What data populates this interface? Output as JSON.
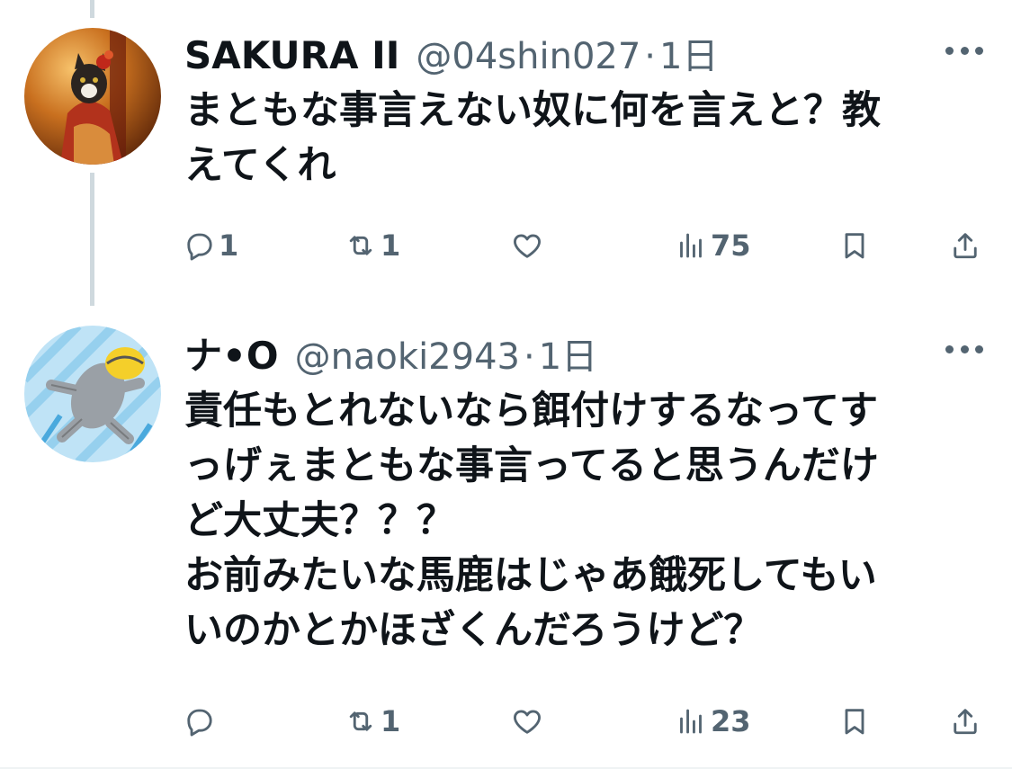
{
  "tweets": [
    {
      "name": "SAKURA II",
      "handle": "@04shin027",
      "separator": "·",
      "time": "1日",
      "text": "まともな事言えない奴に何を言えと？教\nえてくれ",
      "reply_count": "1",
      "retweet_count": "1",
      "like_count": "",
      "view_count": "75"
    },
    {
      "name": "ナ•O",
      "handle": "@naoki2943",
      "separator": "·",
      "time": "1日",
      "text": "責任もとれないなら餌付けするなってす\nっげぇまともな事言ってると思うんだけ\nど大丈夫？？？\nお前みたいな馬鹿はじゃあ餓死してもい\nいのかとかほざくんだろうけど？",
      "reply_count": "",
      "retweet_count": "1",
      "like_count": "",
      "view_count": "23"
    }
  ],
  "icons": {
    "reply": "reply-icon",
    "retweet": "retweet-icon",
    "like": "heart-icon",
    "views": "views-icon",
    "bookmark": "bookmark-icon",
    "share": "share-icon",
    "more": "more-icon"
  },
  "colors": {
    "text": "#0f1419",
    "secondary": "#536471",
    "thread_line": "#cfd9de"
  }
}
